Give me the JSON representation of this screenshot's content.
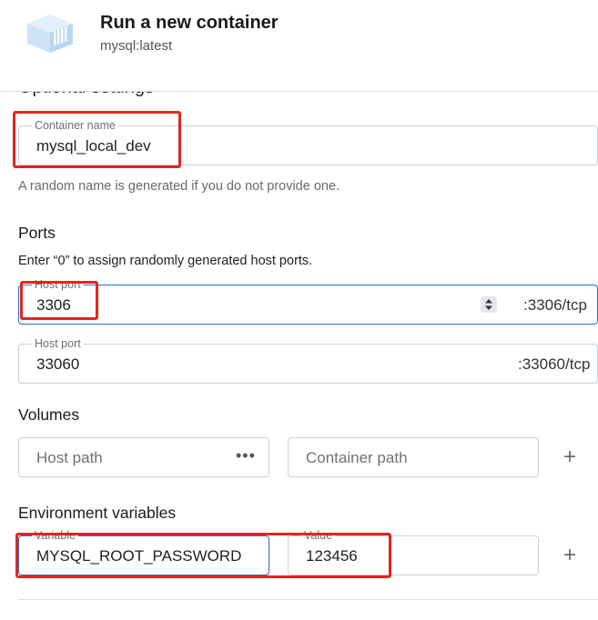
{
  "header": {
    "title": "Run a new container",
    "image": "mysql:latest",
    "logo_icon": "container-cube-icon"
  },
  "optional_settings": {
    "heading": "Optional settings",
    "collapse_icon": "chevron-up-icon"
  },
  "container_name": {
    "label": "Container name",
    "value": "mysql_local_dev",
    "helper": "A random name is generated if you do not provide one."
  },
  "ports": {
    "title": "Ports",
    "description": "Enter “0” to assign randomly generated host ports.",
    "rows": [
      {
        "label": "Host port",
        "value": "3306",
        "container_port": ":3306/tcp"
      },
      {
        "label": "Host port",
        "value": "33060",
        "container_port": ":33060/tcp"
      }
    ]
  },
  "volumes": {
    "title": "Volumes",
    "host_path_placeholder": "Host path",
    "container_path_placeholder": "Container path",
    "browse_icon": "more-horizontal-icon",
    "add_icon": "plus-icon"
  },
  "env": {
    "title": "Environment variables",
    "variable_label": "Variable",
    "value_label": "Value",
    "variable": "MYSQL_ROOT_PASSWORD",
    "value": "123456",
    "add_icon": "plus-icon"
  },
  "colors": {
    "highlight": "#e0261f",
    "focus": "#2b6bd6",
    "border": "#c9ced4"
  }
}
